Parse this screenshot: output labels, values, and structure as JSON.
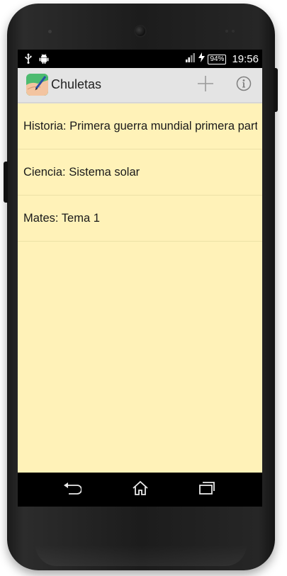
{
  "status_bar": {
    "battery": "94%",
    "time": "19:56"
  },
  "action_bar": {
    "title": "Chuletas"
  },
  "notes": [
    {
      "label": "Historia: Primera guerra mundial primera parte"
    },
    {
      "label": "Ciencia: Sistema solar"
    },
    {
      "label": "Mates: Tema 1"
    }
  ],
  "icons": {
    "usb": "usb-icon",
    "android": "android-icon",
    "signal": "signal-icon",
    "charging": "charging-icon",
    "add": "add-icon",
    "info": "info-icon",
    "back": "back-icon",
    "home": "home-icon",
    "recents": "recents-icon"
  },
  "colors": {
    "list_background": "#fff2b8",
    "action_bar": "#e4e4e4",
    "app_icon": "#43b86a"
  }
}
